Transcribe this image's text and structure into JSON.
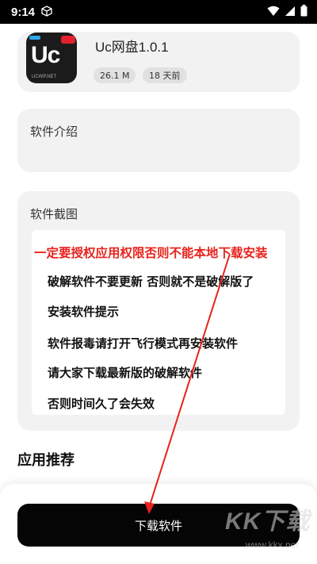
{
  "status_bar": {
    "time": "9:14"
  },
  "app": {
    "name": "Uc网盘1.0.1",
    "size": "26.1 M",
    "updated": "18 天前",
    "icon_text": "Uc",
    "icon_sub": "UCWP.NET"
  },
  "sections": {
    "intro_label": "软件介绍",
    "screenshots_label": "软件截图",
    "recommend_title": "应用推荐"
  },
  "notice": {
    "headline": "一定要授权应用权限否则不能本地下载安装",
    "lines": [
      "破解软件不要更新 否则就不是破解版了",
      "安装软件提示",
      "软件报毒请打开飞行模式再安装软件",
      "请大家下载最新版的破解软件",
      "否则时间久了会失效"
    ]
  },
  "actions": {
    "download_label": "下载软件"
  },
  "watermark": {
    "main": "KK下载",
    "sub": "www.kkx.net"
  },
  "colors": {
    "accent_red": "#e8221c",
    "button_bg": "#050505",
    "card_bg": "#f2f2f2"
  }
}
